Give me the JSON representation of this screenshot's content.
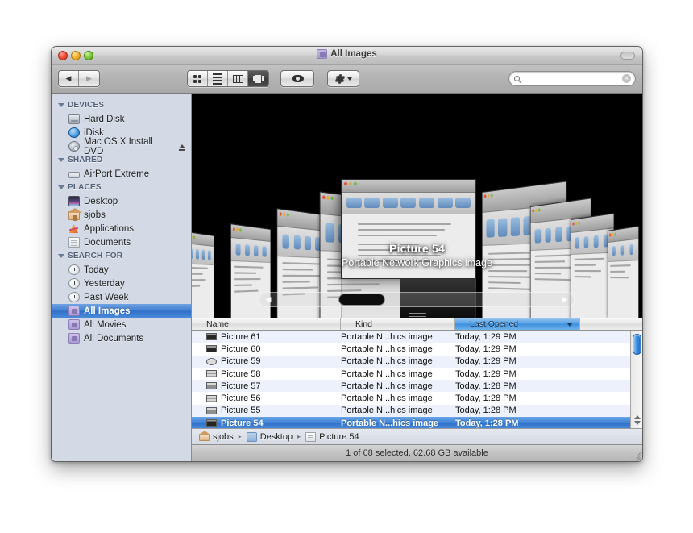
{
  "window": {
    "title": "All Images",
    "title_icon": "smart-folder-icon",
    "traffic_lights": [
      "close-red",
      "minimize-yellow",
      "zoom-green"
    ]
  },
  "toolbar": {
    "back_label": "◀",
    "forward_label": "▶",
    "view_modes": [
      {
        "name": "icon-view",
        "selected": false
      },
      {
        "name": "list-view",
        "selected": false
      },
      {
        "name": "column-view",
        "selected": false
      },
      {
        "name": "coverflow-view",
        "selected": true
      }
    ],
    "quicklook_icon": "eye-icon",
    "action_icon": "gear-icon",
    "search": {
      "value": "",
      "placeholder": "",
      "icon": "search-icon",
      "clear_label": "×"
    }
  },
  "sidebar": {
    "sections": [
      {
        "header": "DEVICES",
        "items": [
          {
            "label": "Hard Disk",
            "icon": "harddisk-icon",
            "selected": false,
            "eject": false
          },
          {
            "label": "iDisk",
            "icon": "idisk-icon",
            "selected": false,
            "eject": false
          },
          {
            "label": "Mac OS X Install DVD",
            "icon": "dvd-icon",
            "selected": false,
            "eject": true
          }
        ]
      },
      {
        "header": "SHARED",
        "items": [
          {
            "label": "AirPort Extreme",
            "icon": "airport-icon",
            "selected": false,
            "eject": false
          }
        ]
      },
      {
        "header": "PLACES",
        "items": [
          {
            "label": "Desktop",
            "icon": "desktop-icon",
            "selected": false,
            "eject": false
          },
          {
            "label": "sjobs",
            "icon": "home-icon",
            "selected": false,
            "eject": false
          },
          {
            "label": "Applications",
            "icon": "applications-icon",
            "selected": false,
            "eject": false
          },
          {
            "label": "Documents",
            "icon": "documents-icon",
            "selected": false,
            "eject": false
          }
        ]
      },
      {
        "header": "SEARCH FOR",
        "items": [
          {
            "label": "Today",
            "icon": "clock-icon",
            "selected": false,
            "eject": false
          },
          {
            "label": "Yesterday",
            "icon": "clock-icon",
            "selected": false,
            "eject": false
          },
          {
            "label": "Past Week",
            "icon": "clock-icon",
            "selected": false,
            "eject": false
          },
          {
            "label": "All Images",
            "icon": "smart-folder-icon",
            "selected": true,
            "eject": false
          },
          {
            "label": "All Movies",
            "icon": "smart-folder-icon",
            "selected": false,
            "eject": false
          },
          {
            "label": "All Documents",
            "icon": "smart-folder-icon",
            "selected": false,
            "eject": false
          }
        ]
      }
    ]
  },
  "coverflow": {
    "current_title": "Picture 54",
    "current_kind": "Portable Network Graphics image",
    "background_color": "#000000",
    "scroller": {
      "left_arrow": "◀",
      "right_arrow": "▶",
      "thumb_position_percent": 22
    }
  },
  "file_list": {
    "columns": [
      {
        "label": "Name",
        "sorted": false
      },
      {
        "label": "Kind",
        "sorted": false
      },
      {
        "label": "Last Opened",
        "sorted": true,
        "direction": "descending"
      }
    ],
    "rows": [
      {
        "name": "Picture 61",
        "kind": "Portable N...hics image",
        "last_opened": "Today, 1:29 PM",
        "selected": false,
        "thumb": "dark"
      },
      {
        "name": "Picture 60",
        "kind": "Portable N...hics image",
        "last_opened": "Today, 1:29 PM",
        "selected": false,
        "thumb": "dark"
      },
      {
        "name": "Picture 59",
        "kind": "Portable N...hics image",
        "last_opened": "Today, 1:29 PM",
        "selected": false,
        "thumb": "light"
      },
      {
        "name": "Picture 58",
        "kind": "Portable N...hics image",
        "last_opened": "Today, 1:29 PM",
        "selected": false,
        "thumb": "striped"
      },
      {
        "name": "Picture 57",
        "kind": "Portable N...hics image",
        "last_opened": "Today, 1:28 PM",
        "selected": false,
        "thumb": "normal"
      },
      {
        "name": "Picture 56",
        "kind": "Portable N...hics image",
        "last_opened": "Today, 1:28 PM",
        "selected": false,
        "thumb": "striped"
      },
      {
        "name": "Picture 55",
        "kind": "Portable N...hics image",
        "last_opened": "Today, 1:28 PM",
        "selected": false,
        "thumb": "normal"
      },
      {
        "name": "Picture 54",
        "kind": "Portable N...hics image",
        "last_opened": "Today, 1:28 PM",
        "selected": true,
        "thumb": "dark"
      }
    ]
  },
  "path_bar": {
    "items": [
      {
        "label": "sjobs",
        "icon": "home-icon"
      },
      {
        "label": "Desktop",
        "icon": "folder-icon"
      },
      {
        "label": "Picture 54",
        "icon": "file-icon"
      }
    ],
    "separator": "▸"
  },
  "status_bar": {
    "text": "1 of 68 selected, 62.68 GB available"
  }
}
